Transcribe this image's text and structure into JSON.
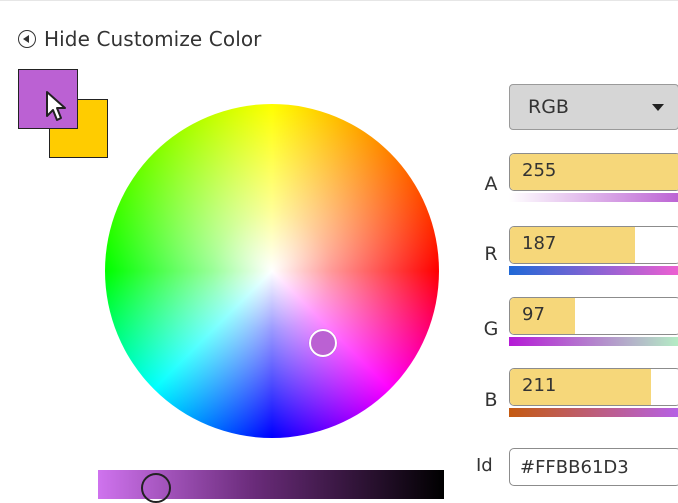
{
  "toggle": {
    "label": "Hide Customize Color"
  },
  "colors": {
    "selected": "#BB61D3",
    "previous": "#FFCC00",
    "accent_fill": "#F6D77A"
  },
  "mode": {
    "value": "RGB"
  },
  "channels": [
    {
      "label": "A",
      "value": "255",
      "fraction": 1.0
    },
    {
      "label": "R",
      "value": "187",
      "fraction": 0.733
    },
    {
      "label": "G",
      "value": "97",
      "fraction": 0.38
    },
    {
      "label": "B",
      "value": "211",
      "fraction": 0.827
    }
  ],
  "id": {
    "label": "Id",
    "value": "#FFBB61D3"
  },
  "icons": {
    "toggle": "collapse-circle-icon",
    "cursor": "mouse-pointer-icon",
    "dropdown": "chevron-down-icon"
  }
}
